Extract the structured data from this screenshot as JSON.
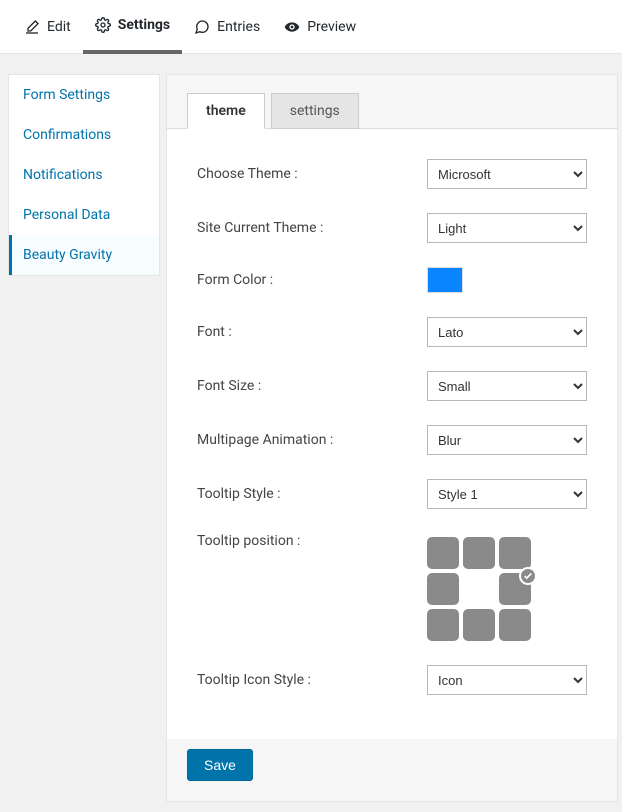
{
  "topbar": {
    "edit": "Edit",
    "settings": "Settings",
    "entries": "Entries",
    "preview": "Preview"
  },
  "sidebar": {
    "items": [
      {
        "label": "Form Settings"
      },
      {
        "label": "Confirmations"
      },
      {
        "label": "Notifications"
      },
      {
        "label": "Personal Data"
      },
      {
        "label": "Beauty Gravity"
      }
    ]
  },
  "tabs": {
    "theme": "theme",
    "settings": "settings"
  },
  "fields": {
    "choose_theme": {
      "label": "Choose Theme :",
      "value": "Microsoft"
    },
    "site_theme": {
      "label": "Site Current Theme :",
      "value": "Light"
    },
    "form_color": {
      "label": "Form Color :",
      "value": "#0a84ff"
    },
    "font": {
      "label": "Font :",
      "value": "Lato"
    },
    "font_size": {
      "label": "Font Size :",
      "value": "Small"
    },
    "multipage_anim": {
      "label": "Multipage Animation :",
      "value": "Blur"
    },
    "tooltip_style": {
      "label": "Tooltip Style :",
      "value": "Style 1"
    },
    "tooltip_position": {
      "label": "Tooltip position :"
    },
    "tooltip_icon_style": {
      "label": "Tooltip Icon Style :",
      "value": "Icon"
    }
  },
  "buttons": {
    "save": "Save"
  }
}
